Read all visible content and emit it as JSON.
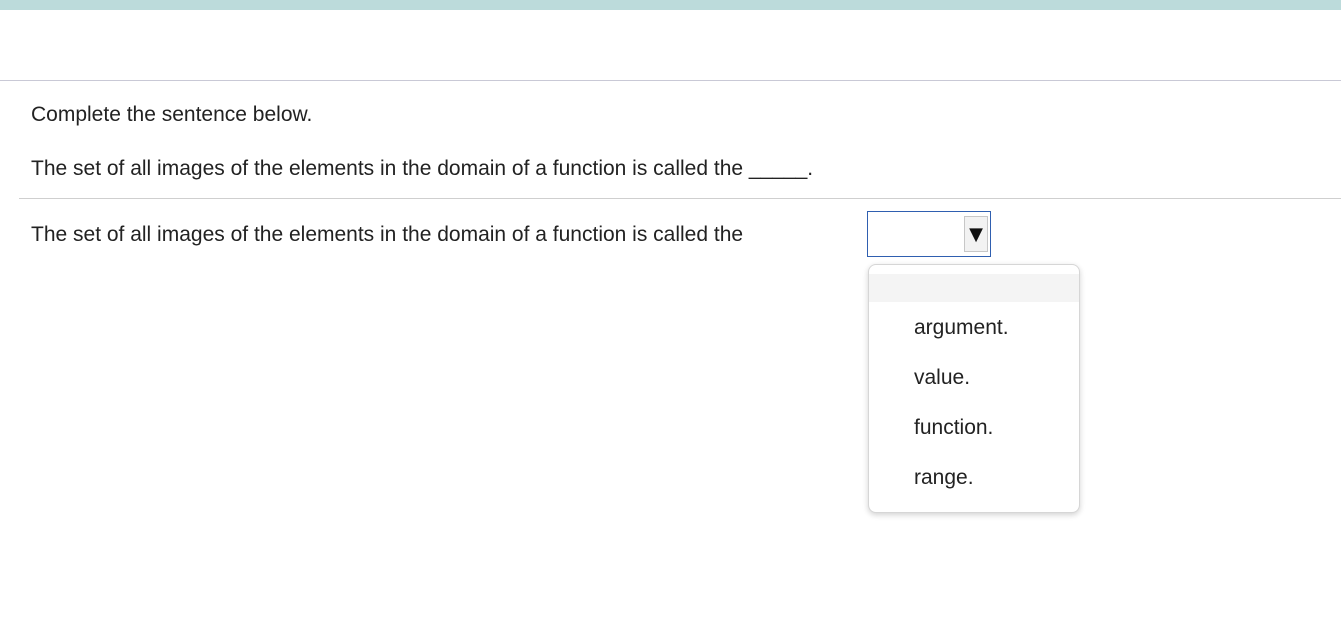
{
  "colors": {
    "top_bar": "#bcdbdb",
    "select_border": "#2f5fb0",
    "text": "#222222"
  },
  "question": {
    "instruction": "Complete the sentence below.",
    "prompt": "The set of all images of the elements in the domain of a function is called the _____."
  },
  "answer": {
    "sentence": "The set of all images of the elements in the domain of a function is called the",
    "selected_value": "",
    "arrow_icon": "▼",
    "options": [
      "",
      "argument.",
      "value.",
      "function.",
      "range."
    ]
  }
}
